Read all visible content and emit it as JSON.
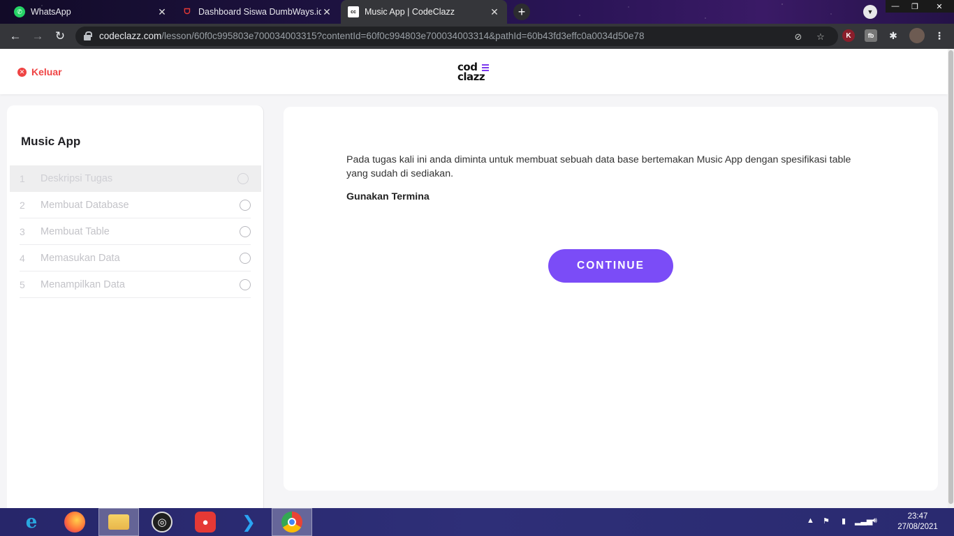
{
  "browser": {
    "tabs": [
      {
        "title": "WhatsApp",
        "favicon": "whatsapp-icon",
        "active": false
      },
      {
        "title": "Dashboard Siswa DumbWays.id |",
        "favicon": "dumbways-icon",
        "active": false
      },
      {
        "title": "Music App | CodeClazz",
        "favicon": "codeclazz-icon",
        "active": true
      }
    ],
    "url_domain": "codeclazz.com",
    "url_path": "/lesson/60f0c995803e700034003315?contentId=60f0c994803e700034003314&pathId=60b43fd3effc0a0034d50e78",
    "extensions": [
      "K",
      "fb"
    ]
  },
  "header": {
    "exit_label": "Keluar",
    "logo_line1": "cod",
    "logo_line2": "clazz"
  },
  "sidebar": {
    "title": "Music App",
    "steps": [
      {
        "num": "1",
        "label": "Deskripsi Tugas",
        "active": true
      },
      {
        "num": "2",
        "label": "Membuat Database",
        "active": false
      },
      {
        "num": "3",
        "label": "Membuat Table",
        "active": false
      },
      {
        "num": "4",
        "label": "Memasukan Data",
        "active": false
      },
      {
        "num": "5",
        "label": "Menampilkan Data",
        "active": false
      }
    ]
  },
  "content": {
    "description": "Pada tugas kali ini anda diminta untuk membuat sebuah data base bertemakan Music App dengan spesifikasi table yang sudah di sediakan.",
    "instruction": "Gunakan Termina",
    "continue_label": "CONTINUE"
  },
  "taskbar": {
    "time": "23:47",
    "date": "27/08/2021"
  },
  "colors": {
    "accent": "#7b4cf7",
    "exit": "#ef4444"
  }
}
